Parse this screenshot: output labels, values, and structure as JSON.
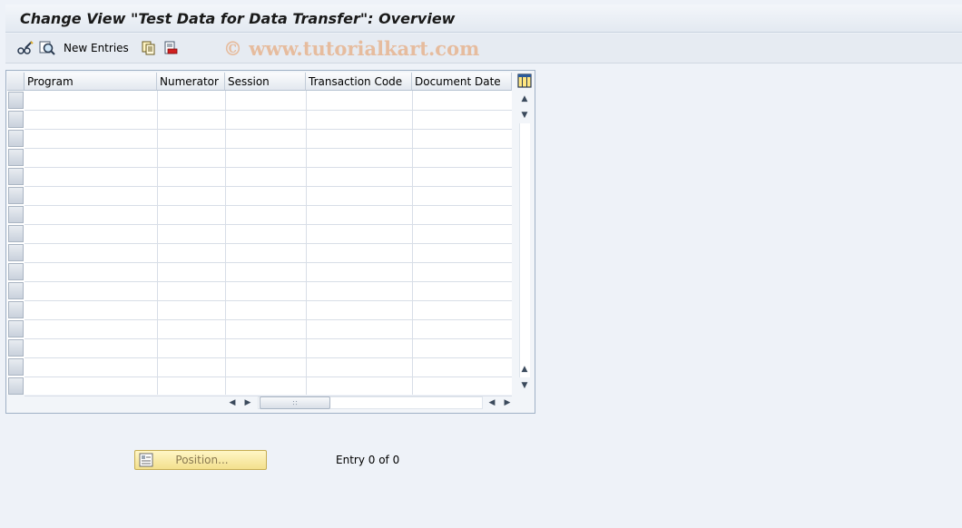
{
  "window": {
    "title": "Change View \"Test Data for Data Transfer\": Overview"
  },
  "toolbar": {
    "display_change_icon": "glasses-pencil-icon",
    "find_icon": "find-magnifier-icon",
    "new_entries_label": "New Entries",
    "copy_icon": "copy-as-icon",
    "delete_icon": "delete-icon"
  },
  "watermark": "© www.tutorialkart.com",
  "table": {
    "columns": [
      "Program",
      "Numerator",
      "Session",
      "Transaction Code",
      "Document Date"
    ],
    "visible_rows": 16,
    "settings_icon": "table-settings-icon"
  },
  "footer": {
    "position_label": "Position...",
    "entry_text": "Entry 0 of 0"
  },
  "colors": {
    "background": "#eef2f8",
    "button_yellow": "#f3e08d"
  }
}
